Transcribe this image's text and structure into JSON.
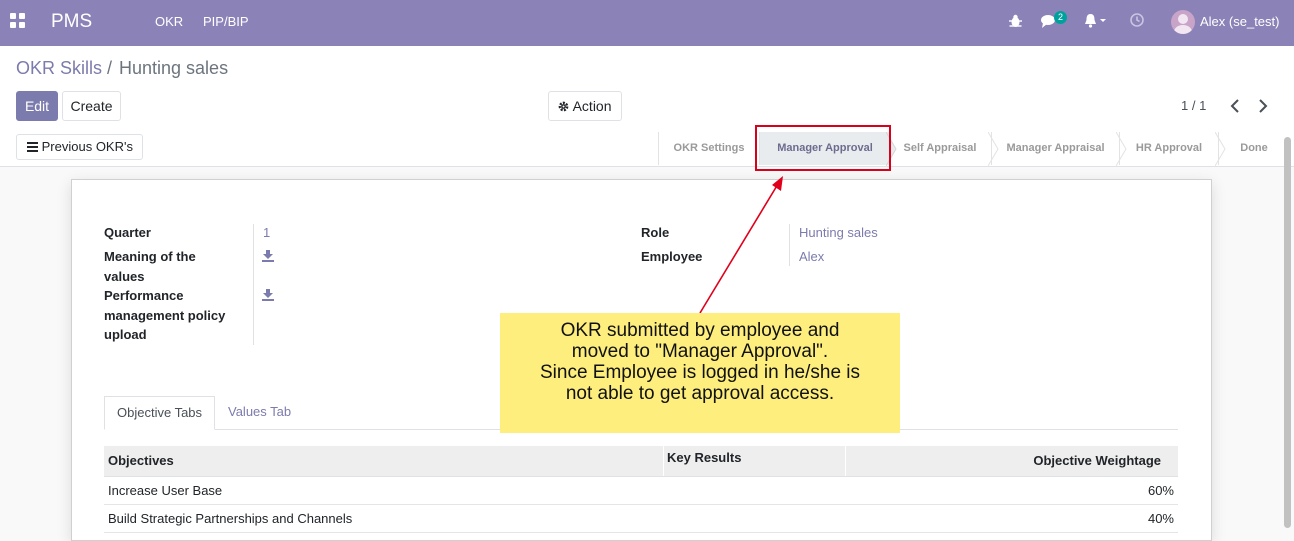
{
  "navbar": {
    "brand": "PMS",
    "menu": [
      "OKR",
      "PIP/BIP"
    ],
    "messages_count": "2",
    "user": "Alex (se_test)"
  },
  "breadcrumb": {
    "parent": "OKR Skills",
    "separator": "/",
    "current": "Hunting sales"
  },
  "buttons": {
    "edit": "Edit",
    "create": "Create",
    "action": "Action"
  },
  "pager": {
    "value": "1 / 1"
  },
  "statusbar": {
    "previous_okrs": "Previous OKR's",
    "stages": [
      "OKR Settings",
      "Manager Approval",
      "Self Appraisal",
      "Manager Appraisal",
      "HR Approval",
      "Done"
    ],
    "active_stage": "Manager Approval"
  },
  "form": {
    "quarter_label": "Quarter",
    "quarter_value": "1",
    "meaning_label_1": "Meaning of the",
    "meaning_label_2": "values",
    "policy_label_1": "Performance",
    "policy_label_2": "management policy",
    "policy_label_3": "upload",
    "role_label": "Role",
    "role_value": "Hunting sales",
    "employee_label": "Employee",
    "employee_value": "Alex"
  },
  "tabs": [
    "Objective Tabs",
    "Values Tab"
  ],
  "table": {
    "headers": [
      "Objectives",
      "Key Results",
      "Objective Weightage"
    ],
    "rows": [
      {
        "objective": "Increase User Base",
        "key_results": "",
        "weightage": "60%"
      },
      {
        "objective": "Build Strategic Partnerships and Channels",
        "key_results": "",
        "weightage": "40%"
      }
    ]
  },
  "callout": {
    "line1": "OKR submitted by employee and",
    "line2": "moved to \"Manager Approval\".",
    "line3": "Since Employee is logged in he/she is",
    "line4": "not able to get approval access."
  },
  "colors": {
    "navbar": "#8b83b8",
    "accent": "#7c7bad",
    "highlight": "#d9001b",
    "callout": "#fdee7d"
  }
}
